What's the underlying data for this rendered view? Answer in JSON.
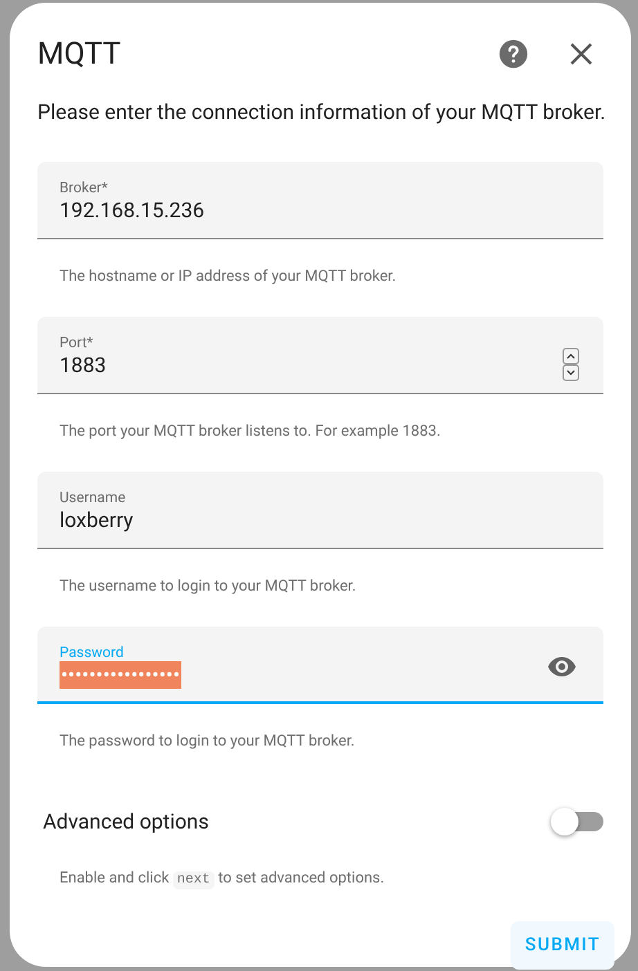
{
  "dialog": {
    "title": "MQTT",
    "description": "Please enter the connection information of your MQTT broker."
  },
  "fields": [
    {
      "kind": "text",
      "label": "Broker*",
      "value": "192.168.15.236",
      "helper": "The hostname or IP address of your MQTT broker.",
      "focused": false
    },
    {
      "kind": "number",
      "label": "Port*",
      "value": "1883",
      "helper": "The port your MQTT broker listens to. For example 1883.",
      "focused": false
    },
    {
      "kind": "text",
      "label": "Username",
      "value": "loxberry",
      "helper": "The username to login to your MQTT broker.",
      "focused": false
    },
    {
      "kind": "password",
      "label": "Password",
      "value": "•••••••••••••••••",
      "helper": "The password to login to your MQTT broker.",
      "focused": true,
      "text_selected": true
    }
  ],
  "advanced": {
    "label": "Advanced options",
    "on": false,
    "helper_before": "Enable and click",
    "helper_code": "next",
    "helper_after": "to set advanced options."
  },
  "submit": {
    "label": "SUBMIT"
  }
}
